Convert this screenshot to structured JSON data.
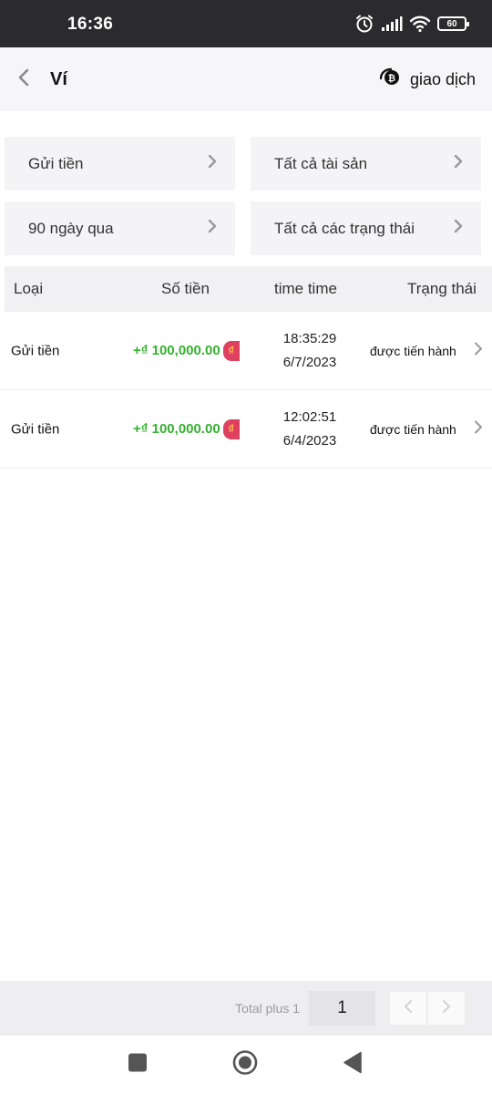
{
  "status_bar": {
    "time": "16:36",
    "battery": "60",
    "icons": [
      "alarm-icon",
      "signal-icon",
      "wifi-icon",
      "battery-icon"
    ]
  },
  "header": {
    "title": "Ví",
    "right_label": "giao dịch",
    "back_icon": "chevron-left-icon",
    "right_icon": "bitcoin-coin-icon"
  },
  "filters": [
    {
      "label": "Gửi tiền"
    },
    {
      "label": "Tất cả tài sản"
    },
    {
      "label": "90 ngày qua"
    },
    {
      "label": "Tất cả các trạng thái"
    }
  ],
  "table": {
    "columns": [
      "Loại",
      "Số tiền",
      "time time",
      "Trạng thái"
    ],
    "rows": [
      {
        "type": "Gửi tiền",
        "amount": "+₫ 100,000.00",
        "coin": "₫",
        "time": "18:35:29",
        "date": "6/7/2023",
        "status": "được tiến hành"
      },
      {
        "type": "Gửi tiền",
        "amount": "+₫ 100,000.00",
        "coin": "₫",
        "time": "12:02:51",
        "date": "6/4/2023",
        "status": "được tiến hành"
      }
    ]
  },
  "pagination": {
    "total_text": "Total plus 1",
    "current_page": "1"
  },
  "colors": {
    "amount_green": "#35b12f",
    "coin_red": "#e0405f",
    "coin_gold": "#f5c240",
    "status_bar_bg": "#2b2b2d"
  },
  "nav_bar": {
    "icons": [
      "square-recent-apps-icon",
      "circle-home-icon",
      "triangle-back-icon"
    ]
  }
}
